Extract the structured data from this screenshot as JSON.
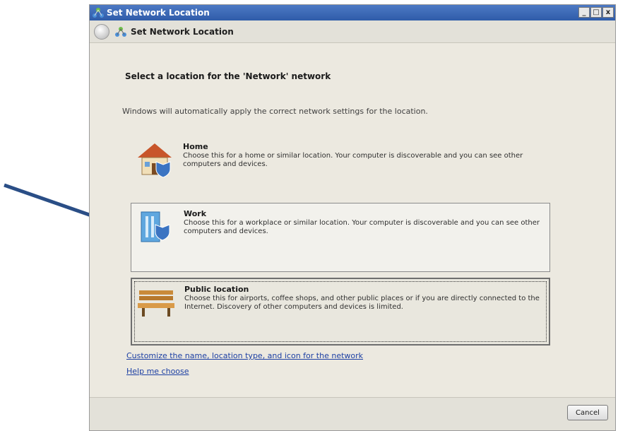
{
  "window": {
    "title": "Set Network Location",
    "controls": {
      "minimize": "_",
      "maximize": "□",
      "close": "x"
    }
  },
  "nav": {
    "title": "Set Network Location",
    "back_icon": "back-arrow-icon",
    "network_icon": "network-icon"
  },
  "main": {
    "heading": "Select a location for the 'Network' network",
    "subtext": "Windows will automatically apply the correct network settings for the location.",
    "options": [
      {
        "label": "Home",
        "description": "Choose this for a home or similar location. Your computer is discoverable and you can see other computers and devices.",
        "icon": "home-icon"
      },
      {
        "label": "Work",
        "description": "Choose this for a workplace or similar location. Your computer is discoverable and you can see other computers and devices.",
        "icon": "work-building-icon"
      },
      {
        "label": "Public location",
        "description": "Choose this for airports, coffee shops, and other public places or if you are directly connected to the Internet. Discovery of other computers and devices is limited.",
        "icon": "park-bench-icon"
      }
    ],
    "links": {
      "customize": "Customize the name, location type, and icon for the network",
      "help": "Help me choose"
    }
  },
  "footer": {
    "cancel_label": "Cancel"
  },
  "colors": {
    "titlebar": "#2f5ca9",
    "link": "#1c3fa3",
    "arrow": "#2a4e86",
    "window_bg": "#ece9e0"
  }
}
